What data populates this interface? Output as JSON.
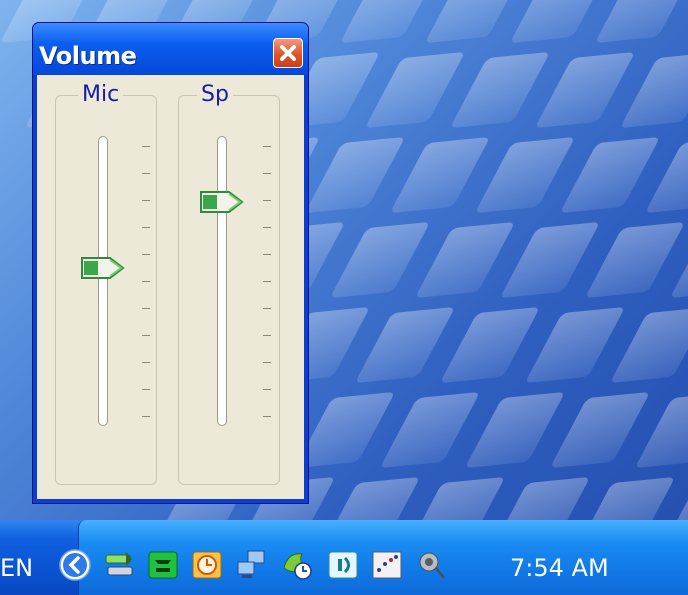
{
  "window": {
    "title": "Volume",
    "close_icon": "close-icon"
  },
  "channels": [
    {
      "label": "Mic",
      "level_percent": 55
    },
    {
      "label": "Sp",
      "level_percent": 80
    }
  ],
  "taskbar": {
    "language": "EN",
    "clock": "7:54 AM",
    "tray_icons": [
      "show-hidden-icons-chevron-icon",
      "network-arrows-icon",
      "phone-connection-icon",
      "clock-app-icon",
      "network-computers-icon",
      "scheduler-icon",
      "audio-device-icon",
      "graph-monitor-icon",
      "speaker-icon"
    ]
  },
  "colors": {
    "titlebar": "#0b5ef0",
    "window_bg": "#ece9d8",
    "close_button": "#e0532a",
    "channel_label": "#1a1aa8",
    "thumb_green": "#3aa84a",
    "taskbar": "#1078e6"
  }
}
